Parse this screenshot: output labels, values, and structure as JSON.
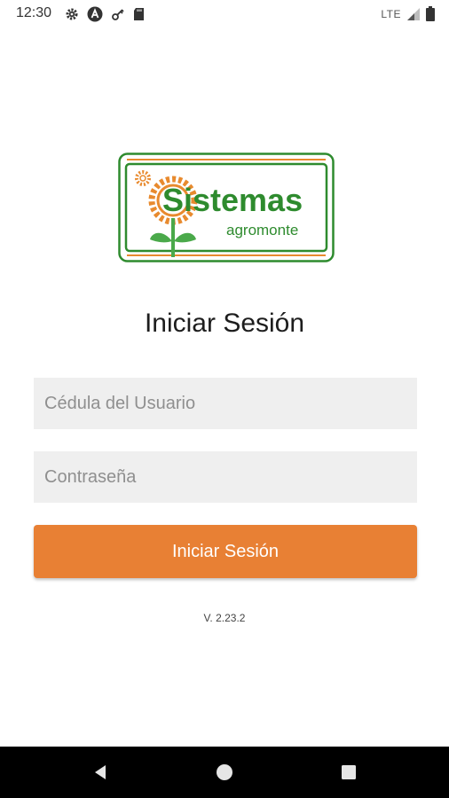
{
  "status_bar": {
    "time": "12:30",
    "network": "LTE",
    "icons": [
      "settings-icon",
      "a-circle-icon",
      "key-icon",
      "sd-card-icon",
      "signal-icon",
      "battery-icon"
    ]
  },
  "logo": {
    "title": "Sistemas",
    "subtitle": "agromonte",
    "colors": {
      "green": "#2e8b2e",
      "orange": "#e88a2e"
    }
  },
  "login": {
    "heading": "Iniciar Sesión",
    "id_placeholder": "Cédula del Usuario",
    "password_placeholder": "Contraseña",
    "button_label": "Iniciar Sesión",
    "button_color": "#e88034"
  },
  "version": "V. 2.23.2",
  "nav_bar": {
    "icons": [
      "back-icon",
      "home-icon",
      "recents-icon"
    ]
  }
}
